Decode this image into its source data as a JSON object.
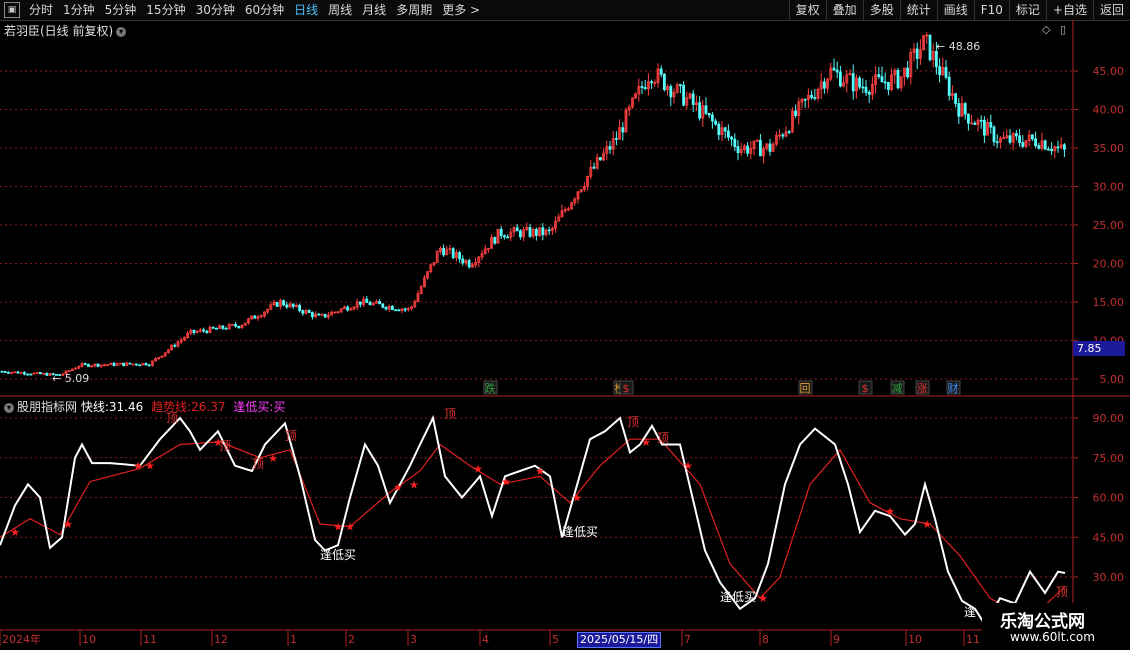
{
  "toolbar": {
    "items": [
      "分时",
      "1分钟",
      "5分钟",
      "15分钟",
      "30分钟",
      "60分钟",
      "日线",
      "周线",
      "月线",
      "多周期",
      "更多"
    ],
    "active": "日线",
    "more_arrow": ">",
    "right": [
      "复权",
      "叠加",
      "多股",
      "统计",
      "画线",
      "F10",
      "标记",
      "+自选",
      "返回"
    ]
  },
  "stock": {
    "name": "若羽臣(日线 前复权)",
    "high_label": "48.86",
    "low_label": "5.09",
    "current_price": "7.85",
    "y_axis": [
      "45.00",
      "40.00",
      "35.00",
      "30.00",
      "25.00",
      "20.00",
      "15.00",
      "10.00",
      "5.00"
    ],
    "markers": [
      {
        "text": "跌",
        "color": "#2ea043"
      },
      {
        "text": "榜",
        "color": "#d8a030"
      },
      {
        "text": "$",
        "color": "#e03030"
      },
      {
        "text": "回",
        "color": "#e8a030"
      },
      {
        "text": "$",
        "color": "#e03030"
      },
      {
        "text": "减",
        "color": "#2ea043"
      },
      {
        "text": "涨",
        "color": "#e03030"
      },
      {
        "text": "财",
        "color": "#3a8cff"
      }
    ]
  },
  "indicator": {
    "name": "股朋指标网",
    "fast_label": "快线:",
    "fast_value": "31.46",
    "trend_label": "趋势线:",
    "trend_value": "26.37",
    "buy_label": "逢低买:",
    "buy_value": "买",
    "y_axis": [
      "90.00",
      "75.00",
      "60.00",
      "45.00",
      "30.00"
    ],
    "top_label": "顶",
    "buy_text": "逢低买"
  },
  "x_axis": {
    "labels": [
      "2024年",
      "10",
      "11",
      "12",
      "1",
      "2",
      "3",
      "4",
      "5",
      "6",
      "7",
      "8",
      "9",
      "10",
      "11"
    ],
    "selected_date": "2025/05/15/四"
  },
  "watermark": {
    "line1": "乐淘公式网",
    "line2": "www.60lt.com"
  },
  "colors": {
    "up": "#ff4040",
    "down": "#54fcfc",
    "fast": "#ffffff",
    "trend": "#e02020",
    "buy": "#ff40ff",
    "grid": "#8a1a1a"
  }
}
